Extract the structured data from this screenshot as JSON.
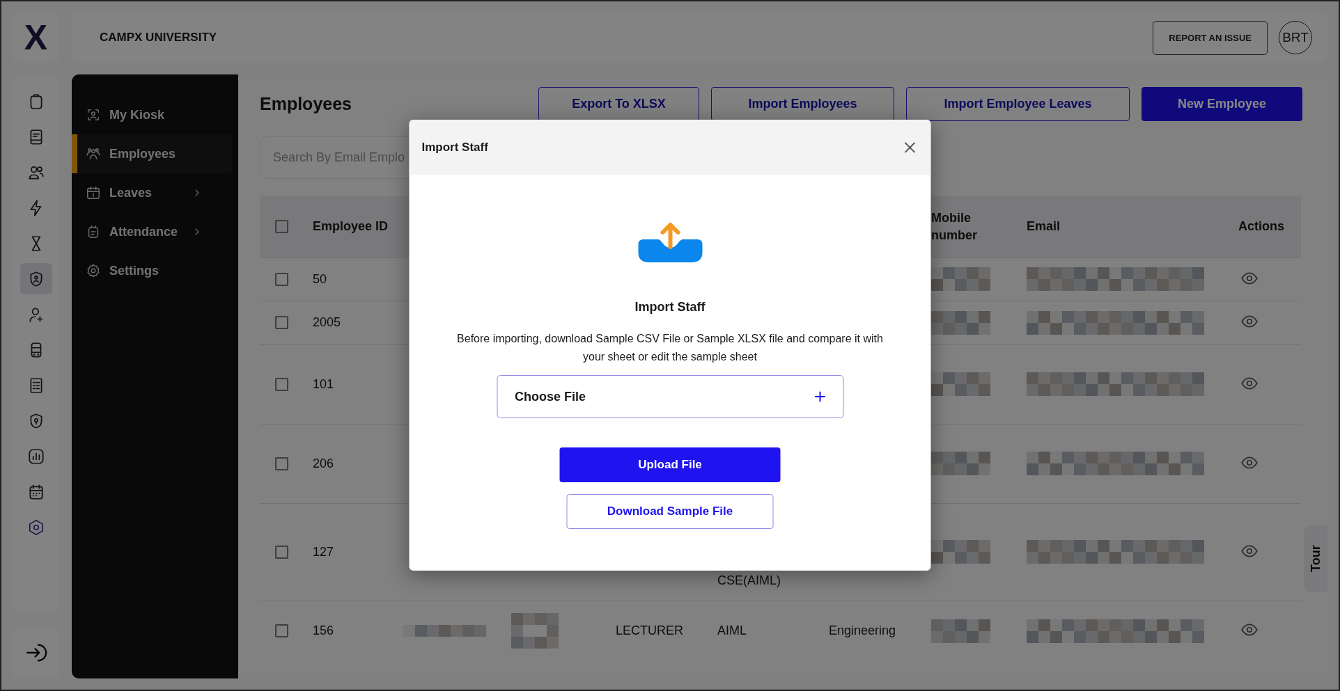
{
  "logo": "X",
  "header": {
    "title": "CAMPX UNIVERSITY",
    "report_button": "REPORT AN ISSUE",
    "avatar": "BRT"
  },
  "rail_items": [
    {
      "selected": false
    },
    {
      "selected": false
    },
    {
      "selected": false
    },
    {
      "selected": false
    },
    {
      "selected": false
    },
    {
      "selected": true
    },
    {
      "selected": false
    },
    {
      "selected": false
    },
    {
      "selected": false
    },
    {
      "selected": false
    },
    {
      "selected": false
    },
    {
      "selected": false
    },
    {
      "selected": false
    }
  ],
  "sidebar": {
    "items": [
      {
        "label": "My Kiosk",
        "selected": false,
        "has_submenu": false
      },
      {
        "label": "Employees",
        "selected": true,
        "has_submenu": false
      },
      {
        "label": "Leaves",
        "selected": false,
        "has_submenu": true
      },
      {
        "label": "Attendance",
        "selected": false,
        "has_submenu": true
      },
      {
        "label": "Settings",
        "selected": false,
        "has_submenu": false
      }
    ]
  },
  "page": {
    "title": "Employees",
    "buttons": [
      {
        "label": "Export To XLSX",
        "kind": "outline"
      },
      {
        "label": "Import Employees",
        "kind": "outline"
      },
      {
        "label": "Import Employee Leaves",
        "kind": "outline"
      },
      {
        "label": "New Employee",
        "kind": "primary"
      }
    ],
    "search": {
      "placeholder": "Search By Email Emplo"
    }
  },
  "table": {
    "select_all_checked": false,
    "columns": [
      "Employee ID",
      null,
      null,
      null,
      null,
      null,
      "Mobile number",
      "Email",
      "Actions"
    ],
    "rows": [
      {
        "checked": false,
        "cells": [
          "50",
          null,
          null,
          null,
          null,
          null,
          {
            "kind": "redacted"
          },
          {
            "kind": "redacted"
          },
          {
            "kind": "view"
          }
        ]
      },
      {
        "checked": false,
        "cells": [
          "2005",
          null,
          null,
          null,
          null,
          null,
          {
            "kind": "redacted"
          },
          {
            "kind": "redacted"
          },
          {
            "kind": "view"
          }
        ]
      },
      {
        "checked": false,
        "cells": [
          "101",
          null,
          null,
          null,
          null,
          null,
          {
            "kind": "redacted"
          },
          {
            "kind": "redacted"
          },
          {
            "kind": "view"
          }
        ]
      },
      {
        "checked": false,
        "cells": [
          "206",
          null,
          null,
          null,
          null,
          null,
          {
            "kind": "redacted"
          },
          {
            "kind": "redacted"
          },
          {
            "kind": "view"
          }
        ]
      },
      {
        "checked": false,
        "cells": [
          "127",
          null,
          null,
          null,
          {
            "kind": "clipped",
            "text": "CSE(AIML)"
          },
          null,
          {
            "kind": "redacted"
          },
          {
            "kind": "redacted"
          },
          {
            "kind": "view"
          }
        ]
      },
      {
        "checked": false,
        "cells": [
          "156",
          {
            "kind": "redacted"
          },
          {
            "kind": "redacted"
          },
          "LECTURER",
          "AIML",
          "Engineering",
          {
            "kind": "redacted"
          },
          {
            "kind": "redacted"
          },
          {
            "kind": "view"
          }
        ]
      }
    ]
  },
  "tour_button": "Tour",
  "modal": {
    "title": "Import Staff",
    "heading": "Import Staff",
    "text": "Before importing, download Sample CSV File or Sample XLSX file and compare it with your sheet or edit the sample sheet",
    "file_field": "Choose File",
    "upload_button": "Upload File",
    "download_button": "Download Sample File"
  }
}
